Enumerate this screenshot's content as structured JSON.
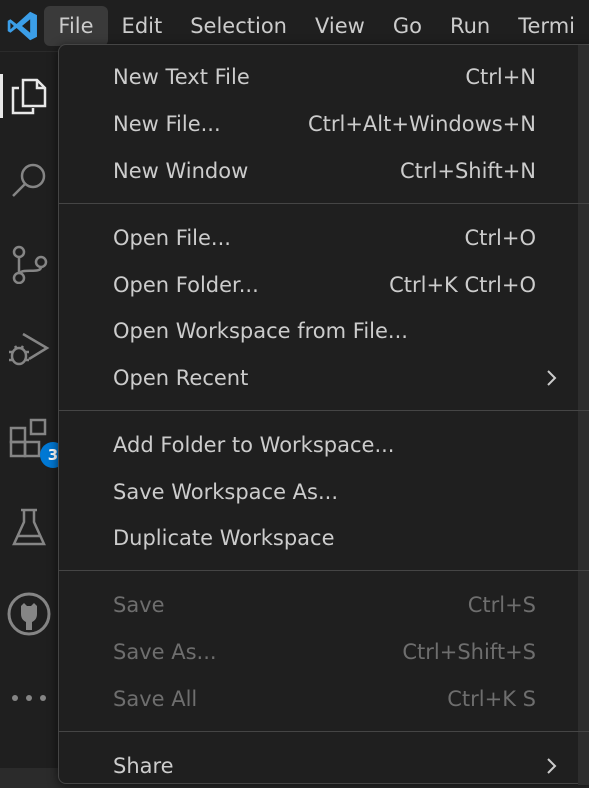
{
  "menubar": {
    "items": [
      "File",
      "Edit",
      "Selection",
      "View",
      "Go",
      "Run",
      "Termi"
    ],
    "active": "File"
  },
  "activitybar": {
    "icons": [
      "explorer-icon",
      "search-icon",
      "source-control-icon",
      "run-debug-icon",
      "extensions-icon",
      "testing-icon",
      "github-icon",
      "more-icon"
    ],
    "extensions_badge": "3"
  },
  "file_menu": {
    "groups": [
      [
        {
          "label": "New Text File",
          "shortcut": "Ctrl+N"
        },
        {
          "label": "New File...",
          "shortcut": "Ctrl+Alt+Windows+N"
        },
        {
          "label": "New Window",
          "shortcut": "Ctrl+Shift+N"
        }
      ],
      [
        {
          "label": "Open File...",
          "shortcut": "Ctrl+O"
        },
        {
          "label": "Open Folder...",
          "shortcut": "Ctrl+K Ctrl+O"
        },
        {
          "label": "Open Workspace from File...",
          "shortcut": ""
        },
        {
          "label": "Open Recent",
          "shortcut": "",
          "submenu": true
        }
      ],
      [
        {
          "label": "Add Folder to Workspace...",
          "shortcut": ""
        },
        {
          "label": "Save Workspace As...",
          "shortcut": ""
        },
        {
          "label": "Duplicate Workspace",
          "shortcut": ""
        }
      ],
      [
        {
          "label": "Save",
          "shortcut": "Ctrl+S",
          "disabled": true
        },
        {
          "label": "Save As...",
          "shortcut": "Ctrl+Shift+S",
          "disabled": true
        },
        {
          "label": "Save All",
          "shortcut": "Ctrl+K S",
          "disabled": true
        }
      ],
      [
        {
          "label": "Share",
          "shortcut": "",
          "submenu": true
        }
      ]
    ]
  },
  "colors": {
    "background": "#1f1f1f",
    "menu_text": "#cccccc",
    "disabled_text": "#6e6e6e",
    "separator": "#454545",
    "logo_blue": "#3b9ee8",
    "badge_blue": "#0078d4"
  }
}
